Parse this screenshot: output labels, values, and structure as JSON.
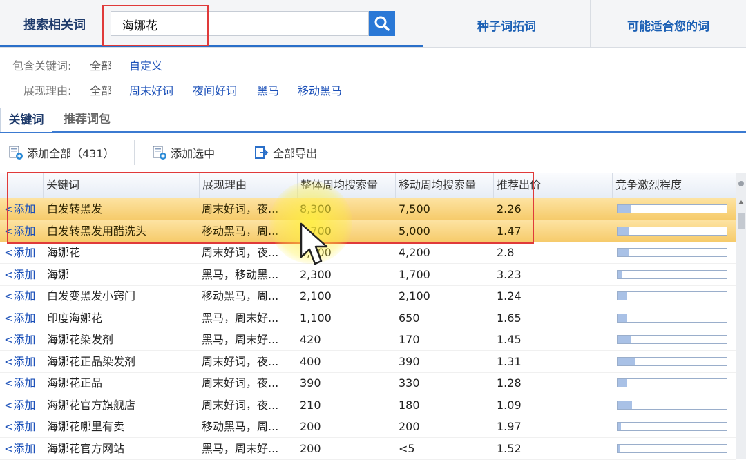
{
  "top_tabs": {
    "search_tab_label": "搜索相关词",
    "seed_tab_label": "种子词拓词",
    "suggest_tab_label": "可能适合您的词"
  },
  "search": {
    "value": "海娜花",
    "icon": "search-icon"
  },
  "filters": {
    "include_label": "包含关键词:",
    "include_options": [
      "全部",
      "自定义"
    ],
    "reason_label": "展现理由:",
    "reason_options": [
      "全部",
      "周末好词",
      "夜间好词",
      "黑马",
      "移动黑马"
    ]
  },
  "subtabs": {
    "active": "关键词",
    "inactive": "推荐词包"
  },
  "toolbar": {
    "add_all_label": "添加全部（431）",
    "add_selected_label": "添加选中",
    "export_all_label": "全部导出"
  },
  "table": {
    "headers": [
      "关键词",
      "展现理由",
      "整体周均搜索量",
      "移动周均搜索量",
      "推荐出价",
      "竞争激烈程度"
    ],
    "add_label": "<添加",
    "rows": [
      {
        "keyword": "白发转黑发",
        "reason": "周末好词，夜...",
        "total": "8,300",
        "mobile": "7,500",
        "bid": "2.26",
        "competition": 0.12,
        "highlight": true
      },
      {
        "keyword": "白发转黑发用醋洗头",
        "reason": "移动黑马，周...",
        "total": "5,700",
        "mobile": "5,000",
        "bid": "1.47",
        "competition": 0.1,
        "highlight": true
      },
      {
        "keyword": "海娜花",
        "reason": "周末好词，夜...",
        "total": "4,800",
        "mobile": "4,200",
        "bid": "2.8",
        "competition": 0.11,
        "highlight": false
      },
      {
        "keyword": "海娜",
        "reason": "黑马，移动黑...",
        "total": "2,300",
        "mobile": "1,700",
        "bid": "3.23",
        "competition": 0.04,
        "highlight": false
      },
      {
        "keyword": "白发变黑发小窍门",
        "reason": "移动黑马，周...",
        "total": "2,100",
        "mobile": "2,100",
        "bid": "1.24",
        "competition": 0.08,
        "highlight": false
      },
      {
        "keyword": "印度海娜花",
        "reason": "黑马，周末好...",
        "total": "1,100",
        "mobile": "650",
        "bid": "1.65",
        "competition": 0.08,
        "highlight": false
      },
      {
        "keyword": "海娜花染发剂",
        "reason": "黑马，周末好...",
        "total": "420",
        "mobile": "170",
        "bid": "1.45",
        "competition": 0.12,
        "highlight": false
      },
      {
        "keyword": "海娜花正品染发剂",
        "reason": "周末好词，夜...",
        "total": "400",
        "mobile": "390",
        "bid": "1.31",
        "competition": 0.16,
        "highlight": false
      },
      {
        "keyword": "海娜花正品",
        "reason": "周末好词，夜...",
        "total": "390",
        "mobile": "330",
        "bid": "1.28",
        "competition": 0.09,
        "highlight": false
      },
      {
        "keyword": "海娜花官方旗舰店",
        "reason": "周末好词，夜...",
        "total": "210",
        "mobile": "180",
        "bid": "1.09",
        "competition": 0.13,
        "highlight": false
      },
      {
        "keyword": "海娜花哪里有卖",
        "reason": "移动黑马，周...",
        "total": "200",
        "mobile": "200",
        "bid": "1.97",
        "competition": 0.03,
        "highlight": false
      },
      {
        "keyword": "海娜花官方网站",
        "reason": "黑马，周末好...",
        "total": "200",
        "mobile": "<5",
        "bid": "1.52",
        "competition": 0.02,
        "highlight": false
      }
    ]
  },
  "colors": {
    "link": "#1a4fb8",
    "highlight": "#f6cb6b",
    "annotation": "#e03a3a",
    "accent": "#2a78d6"
  }
}
